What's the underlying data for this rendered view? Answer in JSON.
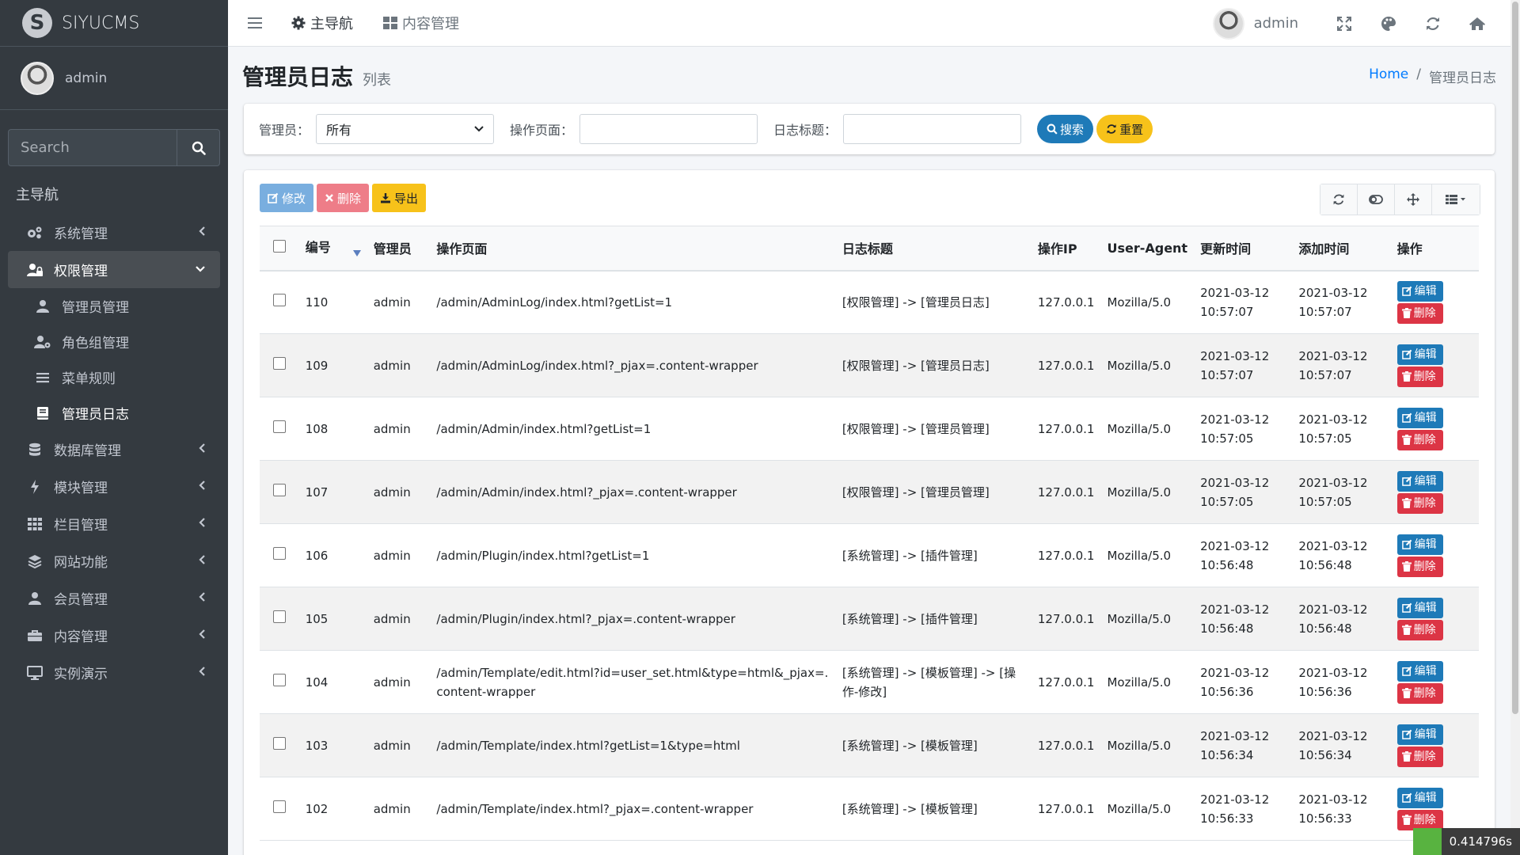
{
  "brand": {
    "logo_letter": "S",
    "name": "SIYUCMS"
  },
  "user": {
    "name": "admin"
  },
  "search": {
    "placeholder": "Search"
  },
  "sidebar": {
    "header": "主导航",
    "items": [
      {
        "label": "系统管理",
        "icon": "gears-icon"
      },
      {
        "label": "权限管理",
        "icon": "user-lock-icon"
      },
      {
        "label": "数据库管理",
        "icon": "database-icon"
      },
      {
        "label": "模块管理",
        "icon": "bolt-icon"
      },
      {
        "label": "栏目管理",
        "icon": "grid-icon"
      },
      {
        "label": "网站功能",
        "icon": "layers-icon"
      },
      {
        "label": "会员管理",
        "icon": "user-icon"
      },
      {
        "label": "内容管理",
        "icon": "briefcase-icon"
      },
      {
        "label": "实例演示",
        "icon": "desktop-icon"
      }
    ],
    "subitems": [
      {
        "label": "管理员管理",
        "icon": "user-icon"
      },
      {
        "label": "角色组管理",
        "icon": "user-cog-icon"
      },
      {
        "label": "菜单规则",
        "icon": "bars-icon"
      },
      {
        "label": "管理员日志",
        "icon": "book-icon"
      }
    ]
  },
  "topbar": {
    "nav1": "主导航",
    "nav2": "内容管理",
    "username": "admin"
  },
  "header": {
    "title": "管理员日志",
    "subtitle": "列表",
    "breadcrumb_home": "Home",
    "breadcrumb_current": "管理员日志"
  },
  "filter": {
    "admin_label": "管理员：",
    "admin_value": "所有",
    "page_label": "操作页面：",
    "title_label": "日志标题：",
    "search_btn": "搜索",
    "reset_btn": "重置"
  },
  "toolbar": {
    "edit": "修改",
    "delete": "删除",
    "export": "导出"
  },
  "table": {
    "headers": [
      "编号",
      "管理员",
      "操作页面",
      "日志标题",
      "操作IP",
      "User-Agent",
      "更新时间",
      "添加时间",
      "操作"
    ],
    "edit_label": "编辑",
    "delete_label": "删除",
    "rows": [
      {
        "id": "110",
        "admin": "admin",
        "page": "/admin/AdminLog/index.html?getList=1",
        "title": "[权限管理] -> [管理员日志]",
        "ip": "127.0.0.1",
        "ua": "Mozilla/5.0",
        "updated_date": "2021-03-12",
        "updated_time": "10:57:07",
        "added_date": "2021-03-12",
        "added_time": "10:57:07"
      },
      {
        "id": "109",
        "admin": "admin",
        "page": "/admin/AdminLog/index.html?_pjax=.content-wrapper",
        "title": "[权限管理] -> [管理员日志]",
        "ip": "127.0.0.1",
        "ua": "Mozilla/5.0",
        "updated_date": "2021-03-12",
        "updated_time": "10:57:07",
        "added_date": "2021-03-12",
        "added_time": "10:57:07"
      },
      {
        "id": "108",
        "admin": "admin",
        "page": "/admin/Admin/index.html?getList=1",
        "title": "[权限管理] -> [管理员管理]",
        "ip": "127.0.0.1",
        "ua": "Mozilla/5.0",
        "updated_date": "2021-03-12",
        "updated_time": "10:57:05",
        "added_date": "2021-03-12",
        "added_time": "10:57:05"
      },
      {
        "id": "107",
        "admin": "admin",
        "page": "/admin/Admin/index.html?_pjax=.content-wrapper",
        "title": "[权限管理] -> [管理员管理]",
        "ip": "127.0.0.1",
        "ua": "Mozilla/5.0",
        "updated_date": "2021-03-12",
        "updated_time": "10:57:05",
        "added_date": "2021-03-12",
        "added_time": "10:57:05"
      },
      {
        "id": "106",
        "admin": "admin",
        "page": "/admin/Plugin/index.html?getList=1",
        "title": "[系统管理] -> [插件管理]",
        "ip": "127.0.0.1",
        "ua": "Mozilla/5.0",
        "updated_date": "2021-03-12",
        "updated_time": "10:56:48",
        "added_date": "2021-03-12",
        "added_time": "10:56:48"
      },
      {
        "id": "105",
        "admin": "admin",
        "page": "/admin/Plugin/index.html?_pjax=.content-wrapper",
        "title": "[系统管理] -> [插件管理]",
        "ip": "127.0.0.1",
        "ua": "Mozilla/5.0",
        "updated_date": "2021-03-12",
        "updated_time": "10:56:48",
        "added_date": "2021-03-12",
        "added_time": "10:56:48"
      },
      {
        "id": "104",
        "admin": "admin",
        "page": "/admin/Template/edit.html?id=user_set.html&type=html&_pjax=.content-wrapper",
        "title": "[系统管理] -> [模板管理] -> [操作-修改]",
        "ip": "127.0.0.1",
        "ua": "Mozilla/5.0",
        "updated_date": "2021-03-12",
        "updated_time": "10:56:36",
        "added_date": "2021-03-12",
        "added_time": "10:56:36"
      },
      {
        "id": "103",
        "admin": "admin",
        "page": "/admin/Template/index.html?getList=1&type=html",
        "title": "[系统管理] -> [模板管理]",
        "ip": "127.0.0.1",
        "ua": "Mozilla/5.0",
        "updated_date": "2021-03-12",
        "updated_time": "10:56:34",
        "added_date": "2021-03-12",
        "added_time": "10:56:34"
      },
      {
        "id": "102",
        "admin": "admin",
        "page": "/admin/Template/index.html?_pjax=.content-wrapper",
        "title": "[系统管理] -> [模板管理]",
        "ip": "127.0.0.1",
        "ua": "Mozilla/5.0",
        "updated_date": "2021-03-12",
        "updated_time": "10:56:33",
        "added_date": "2021-03-12",
        "added_time": "10:56:33"
      }
    ]
  },
  "timer": "0.414796s",
  "colors": {
    "sidebar_bg": "#343a40",
    "primary": "#1e7ab8",
    "danger": "#dc3545",
    "warning": "#f7c21a"
  }
}
